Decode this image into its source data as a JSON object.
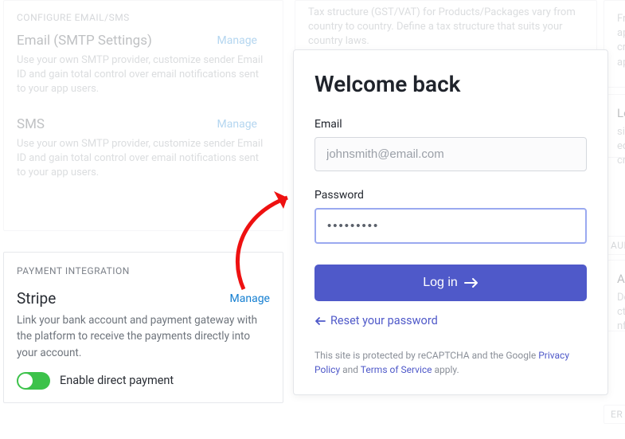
{
  "background": {
    "config_section": {
      "title": "CONFIGURE EMAIL/SMS",
      "email": {
        "title": "Email (SMTP Settings)",
        "manage": "Manage",
        "desc": "Use your own SMTP provider, customize sender Email ID and gain total control over email notifications sent to your app users."
      },
      "sms": {
        "title": "SMS",
        "manage": "Manage",
        "desc": "Use your own SMTP provider, customize sender Email ID and gain total control over email notifications sent to your app users."
      }
    },
    "tax_text": "Tax structure (GST/VAT) for Products/Packages vary from country to country. Define a tax structure that suits your country laws.",
    "right_fragments": {
      "from": "From",
      "app1": "app",
      "cred1": "cred",
      "app2": "app",
      "log": "Log",
      "sign": "sign",
      "edit": "edit",
      "creat": "creat",
      "aud_upper": "AUD",
      "aud_title": "Auc",
      "dow": "Dow",
      "ctiv": "ctiv",
      "nfo": "nfo",
      "er": "ER"
    }
  },
  "payment": {
    "section_title": "PAYMENT INTEGRATION",
    "provider": "Stripe",
    "manage": "Manage",
    "desc": "Link your bank account and payment gateway with the platform to receive the payments directly into your account.",
    "toggle_label": "Enable direct payment"
  },
  "login": {
    "title": "Welcome back",
    "email_label": "Email",
    "email_placeholder": "johnsmith@email.com",
    "password_label": "Password",
    "password_value": "•••••••••",
    "submit": "Log in",
    "reset": "Reset your password",
    "legal_prefix": "This site is protected by reCAPTCHA and the Google ",
    "privacy": "Privacy Policy",
    "legal_and": " and ",
    "terms": "Terms of Service",
    "legal_suffix": " apply."
  }
}
